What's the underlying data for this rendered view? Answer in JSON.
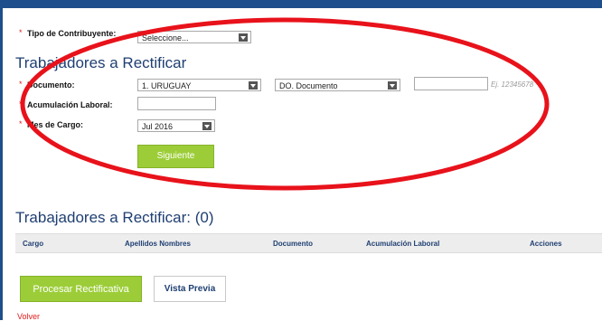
{
  "form": {
    "tipo_contribuyente_label": "Tipo de Contribuyente:",
    "tipo_contribuyente_value": "Seleccione...",
    "section_title": "Trabajadores a Rectificar",
    "documento_label": "Documento:",
    "pais_value": "1. URUGUAY",
    "tipo_documento_value": "DO. Documento",
    "documento_value": "",
    "documento_hint": "Ej. 12345678",
    "acumulacion_label": "Acumulación Laboral:",
    "acumulacion_value": "",
    "mes_label": "Mes de Cargo:",
    "mes_value": "Jul 2016",
    "siguiente_label": "Siguiente",
    "required_mark": "*"
  },
  "table": {
    "title": "Trabajadores a Rectificar: (0)",
    "columns": [
      "Cargo",
      "Apellidos Nombres",
      "Documento",
      "Acumulación Laboral",
      "Acciones"
    ]
  },
  "actions": {
    "procesar_label": "Procesar Rectificativa",
    "vista_previa_label": "Vista Previa",
    "volver_label": "Volver"
  },
  "colors": {
    "annotation_ring": "#e8121b",
    "accent_green": "#9ccd38",
    "heading_blue": "#1f3f72",
    "required_red": "#e01b1b"
  }
}
